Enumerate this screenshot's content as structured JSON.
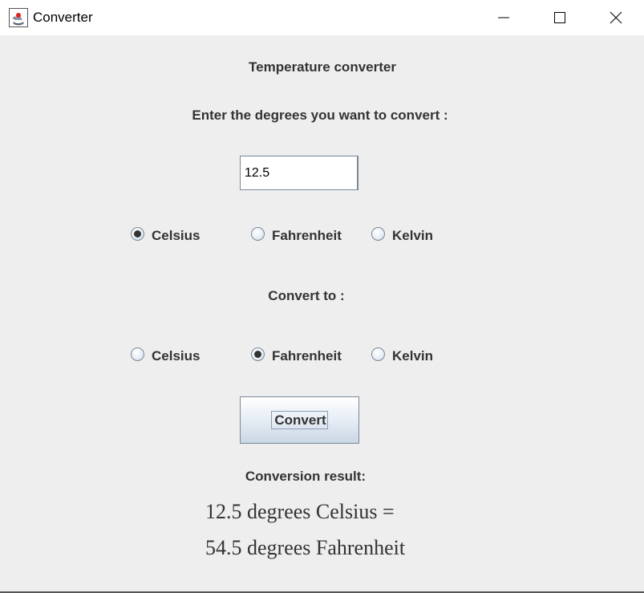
{
  "window": {
    "title": "Converter",
    "app_icon": "java-coffee-icon",
    "controls": [
      "minimize-icon",
      "maximize-icon",
      "close-icon"
    ]
  },
  "main": {
    "heading": "Temperature converter",
    "prompt": "Enter the degrees you want to convert :",
    "degrees_input": {
      "value": "12.5"
    },
    "from_units": [
      {
        "label": "Celsius",
        "checked": true
      },
      {
        "label": "Fahrenheit",
        "checked": false
      },
      {
        "label": "Kelvin",
        "checked": false
      }
    ],
    "convert_to_label": "Convert to :",
    "to_units": [
      {
        "label": "Celsius",
        "checked": false
      },
      {
        "label": "Fahrenheit",
        "checked": true
      },
      {
        "label": "Kelvin",
        "checked": false
      }
    ],
    "convert_button": "Convert",
    "result_heading": "Conversion result:",
    "result_lines": [
      "12.5 degrees Celsius =",
      "54.5 degrees Fahrenheit"
    ]
  }
}
